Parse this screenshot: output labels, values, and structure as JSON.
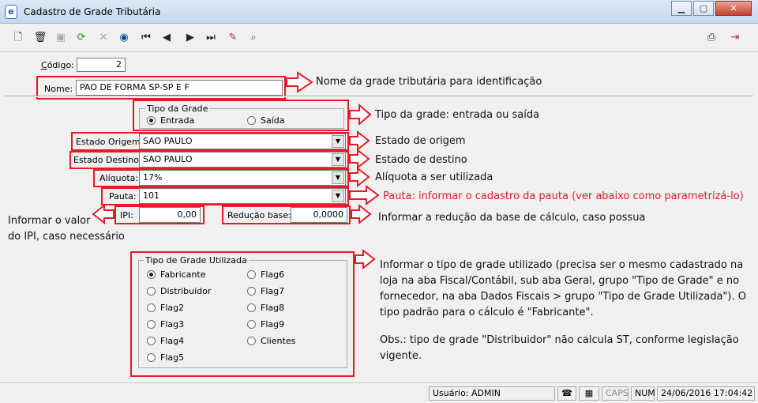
{
  "window": {
    "title": "Cadastro de Grade Tributária",
    "app_icon_glyph": "e",
    "controls": {
      "minimize": "▁",
      "maximize": "▢",
      "close": "✕"
    }
  },
  "toolbar": {
    "icons": [
      "new-icon",
      "delete-icon",
      "save-icon",
      "refresh-icon",
      "cancel-icon",
      "search-icon",
      "first-record-icon",
      "previous-record-icon",
      "next-record-icon",
      "last-record-icon",
      "filter-icon",
      "find-icon",
      "print-icon",
      "exit-icon"
    ]
  },
  "form": {
    "codigo_label": "Código:",
    "codigo_value": "2",
    "nome_label": "Nome:",
    "nome_value": "PAO DE FORMA SP-SP E F",
    "tipo_grade": {
      "title": "Tipo da Grade",
      "options": [
        {
          "label": "Entrada",
          "selected": true
        },
        {
          "label": "Saída",
          "selected": false
        }
      ]
    },
    "estado_origem_label": "Estado Origem:",
    "estado_origem_value": "SAO PAULO",
    "estado_destino_label": "Estado Destino:",
    "estado_destino_value": "SAO PAULO",
    "aliquota_label": "Alíquota:",
    "aliquota_value": "17%",
    "pauta_label": "Pauta:",
    "pauta_value": "101",
    "ipi_label": "IPI:",
    "ipi_value": "0,00",
    "reducao_label": "Redução base:",
    "reducao_value": "0,0000",
    "tipo_grade_utilizada": {
      "title": "Tipo de Grade Utilizada",
      "col1": [
        {
          "label": "Fabricante",
          "selected": true
        },
        {
          "label": "Distribuidor",
          "selected": false
        },
        {
          "label": "Flag2",
          "selected": false
        },
        {
          "label": "Flag3",
          "selected": false
        },
        {
          "label": "Flag4",
          "selected": false
        },
        {
          "label": "Flag5",
          "selected": false
        }
      ],
      "col2": [
        {
          "label": "Flag6",
          "selected": false
        },
        {
          "label": "Flag7",
          "selected": false
        },
        {
          "label": "Flag8",
          "selected": false
        },
        {
          "label": "Flag9",
          "selected": false
        },
        {
          "label": "Clientes",
          "selected": false
        }
      ]
    }
  },
  "annotations": {
    "nome": "Nome da grade tributária para identificação",
    "tipo": "Tipo da grade: entrada ou saída",
    "origem": "Estado de origem",
    "destino": "Estado de destino",
    "aliquota": "Alíquota a ser utilizada",
    "pauta": "Pauta: informar o cadastro da pauta (ver abaixo como parametrizá-lo)",
    "reducao": "Informar a redução da base de cálculo, caso possua",
    "ipi_line1": "Informar o valor",
    "ipi_line2": "do IPI, caso necessário",
    "tgu_lines": [
      "Informar o tipo de grade utilizado (precisa ser o mesmo cadastrado na",
      "loja na aba Fiscal/Contábil, sub aba Geral, grupo \"Tipo de Grade\" e no",
      "fornecedor, na aba Dados Fiscais > grupo \"Tipo de Grade Utilizada\"). O",
      "tipo padrão para o cálculo é \"Fabricante\"."
    ],
    "obs_lines": [
      "Obs.: tipo de grade \"Distribuidor\" não calcula ST, conforme legislação",
      "vigente."
    ],
    "accent_color": "#e31c25"
  },
  "statusbar": {
    "usuario": "Usuário: ADMIN",
    "caps": "CAPS",
    "num": "NUM",
    "datetime": "24/06/2016 17:04:42"
  }
}
